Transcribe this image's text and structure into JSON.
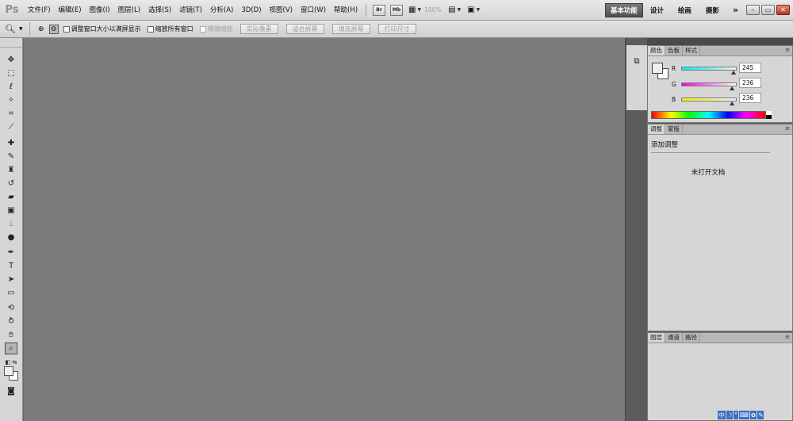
{
  "app": {
    "logo": "Ps"
  },
  "menu": [
    "文件(F)",
    "编辑(E)",
    "图像(I)",
    "图层(L)",
    "选择(S)",
    "滤镜(T)",
    "分析(A)",
    "3D(D)",
    "视图(V)",
    "窗口(W)",
    "帮助(H)"
  ],
  "appbar": {
    "bridge": "Br",
    "mini_bridge": "Mb",
    "zoom": "100%"
  },
  "workspaces": {
    "active": "基本功能",
    "items": [
      "设计",
      "绘画",
      "摄影"
    ],
    "more": "»"
  },
  "window_controls": {
    "minimize": "–",
    "restore": "▭",
    "close": "✕"
  },
  "options": {
    "checks": [
      "调整窗口大小以满屏显示",
      "缩放所有窗口",
      "细微缩放"
    ],
    "buttons": [
      "实际像素",
      "适合屏幕",
      "填充屏幕",
      "打印尺寸"
    ]
  },
  "panels": {
    "color_tabs": [
      "颜色",
      "色板",
      "样式"
    ],
    "color": {
      "channels": [
        {
          "label": "R",
          "value": "245",
          "level": 0.96
        },
        {
          "label": "G",
          "value": "236",
          "level": 0.93
        },
        {
          "label": "B",
          "value": "236",
          "level": 0.93
        }
      ]
    },
    "adjust_tabs": [
      "调整",
      "蒙版"
    ],
    "adjust_title": "添加调整",
    "adjust_message": "未打开文档",
    "layers_tabs": [
      "图层",
      "通道",
      "路径"
    ],
    "menu_icon": "≡"
  },
  "tray": [
    "中",
    "☽",
    "°",
    "⌨",
    "✿",
    "✎"
  ],
  "colors": {
    "canvas": "#7b7b7b",
    "ui": "#d6d6d6",
    "accent": "#4f4f4f"
  }
}
